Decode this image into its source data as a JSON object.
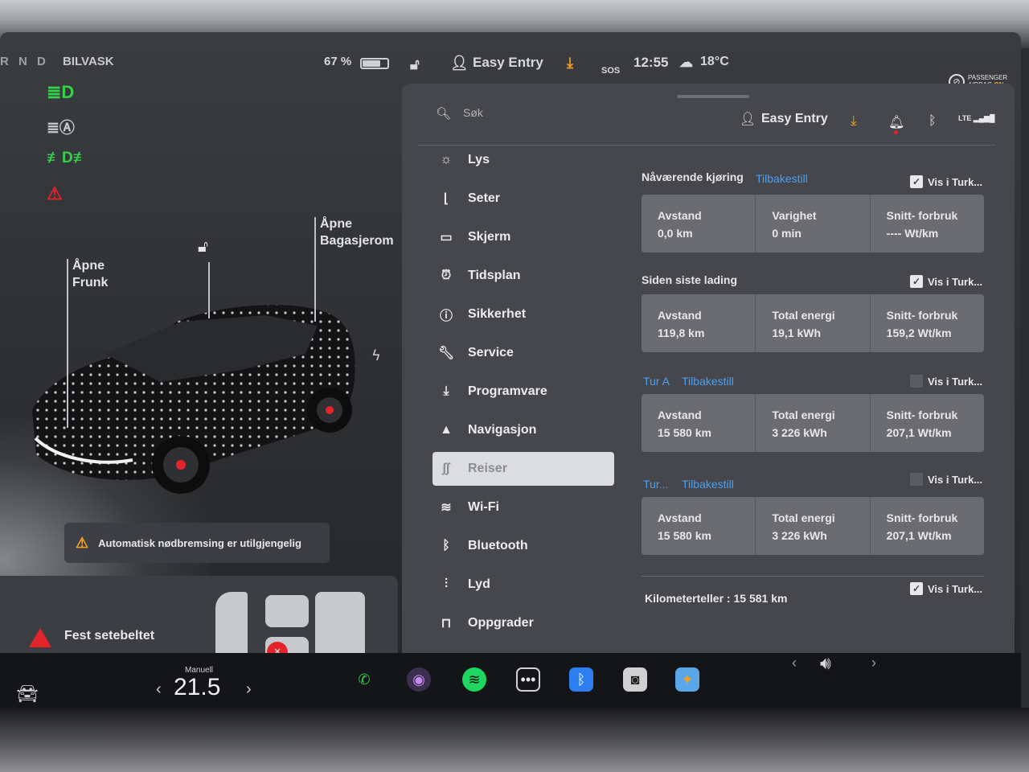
{
  "status": {
    "gear": "R N D",
    "wash": "BILVASK",
    "battery": "67 %",
    "profile": "Easy Entry",
    "sos": "SOS",
    "time": "12:55",
    "temperature": "18°C",
    "airbag_line1": "PASSENGER",
    "airbag_line2": "AIRBAG",
    "airbag_state": "ON"
  },
  "car": {
    "frunk": "Åpne\nFrunk",
    "frunk_l1": "Åpne",
    "frunk_l2": "Frunk",
    "trunk_l1": "Åpne",
    "trunk_l2": "Bagasjerom",
    "aeb_warning": "Automatisk nødbremsing er utilgjengelig",
    "seatbelt": "Fest setebeltet"
  },
  "panel": {
    "search_placeholder": "Søk",
    "profile": "Easy Entry",
    "lte": "LTE",
    "nav": [
      {
        "label": "Lys"
      },
      {
        "label": "Seter"
      },
      {
        "label": "Skjerm"
      },
      {
        "label": "Tidsplan"
      },
      {
        "label": "Sikkerhet"
      },
      {
        "label": "Service"
      },
      {
        "label": "Programvare"
      },
      {
        "label": "Navigasjon"
      },
      {
        "label": "Reiser"
      },
      {
        "label": "Wi-Fi"
      },
      {
        "label": "Bluetooth"
      },
      {
        "label": "Lyd"
      },
      {
        "label": "Oppgrader"
      }
    ],
    "trips": {
      "current": {
        "title": "Nåværende kjøring",
        "reset": "Tilbakestill",
        "show": "Vis i Turk...",
        "c1_label": "Avstand",
        "c1_value": "0,0 km",
        "c2_label": "Varighet",
        "c2_value": "0 min",
        "c3_label": "Snitt- forbruk",
        "c3_value": "---- Wt/km"
      },
      "since_charge": {
        "title": "Siden siste lading",
        "show": "Vis i Turk...",
        "c1_label": "Avstand",
        "c1_value": "119,8 km",
        "c2_label": "Total energi",
        "c2_value": "19,1 kWh",
        "c3_label": "Snitt- forbruk",
        "c3_value": "159,2 Wt/km"
      },
      "trip_a": {
        "title": "Tur A",
        "reset": "Tilbakestill",
        "show": "Vis i Turk...",
        "c1_label": "Avstand",
        "c1_value": "15 580 km",
        "c2_label": "Total energi",
        "c2_value": "3 226 kWh",
        "c3_label": "Snitt- forbruk",
        "c3_value": "207,1 Wt/km"
      },
      "trip_b": {
        "title": "Tur...",
        "reset": "Tilbakestill",
        "show": "Vis i Turk...",
        "c1_label": "Avstand",
        "c1_value": "15 580 km",
        "c2_label": "Total energi",
        "c2_value": "3 226 kWh",
        "c3_label": "Snitt- forbruk",
        "c3_value": "207,1 Wt/km"
      }
    },
    "odometer_label": "Kilometerteller :",
    "odometer_value": "15 581 km",
    "odometer_show": "Vis i Turk..."
  },
  "dock": {
    "climate_mode": "Manuell",
    "climate_temp": "21.5"
  },
  "colors": {
    "accent_blue": "#4aa0f5",
    "warning_orange": "#f4a21e",
    "alert_red": "#e3242b",
    "indicator_green": "#35d24a"
  }
}
